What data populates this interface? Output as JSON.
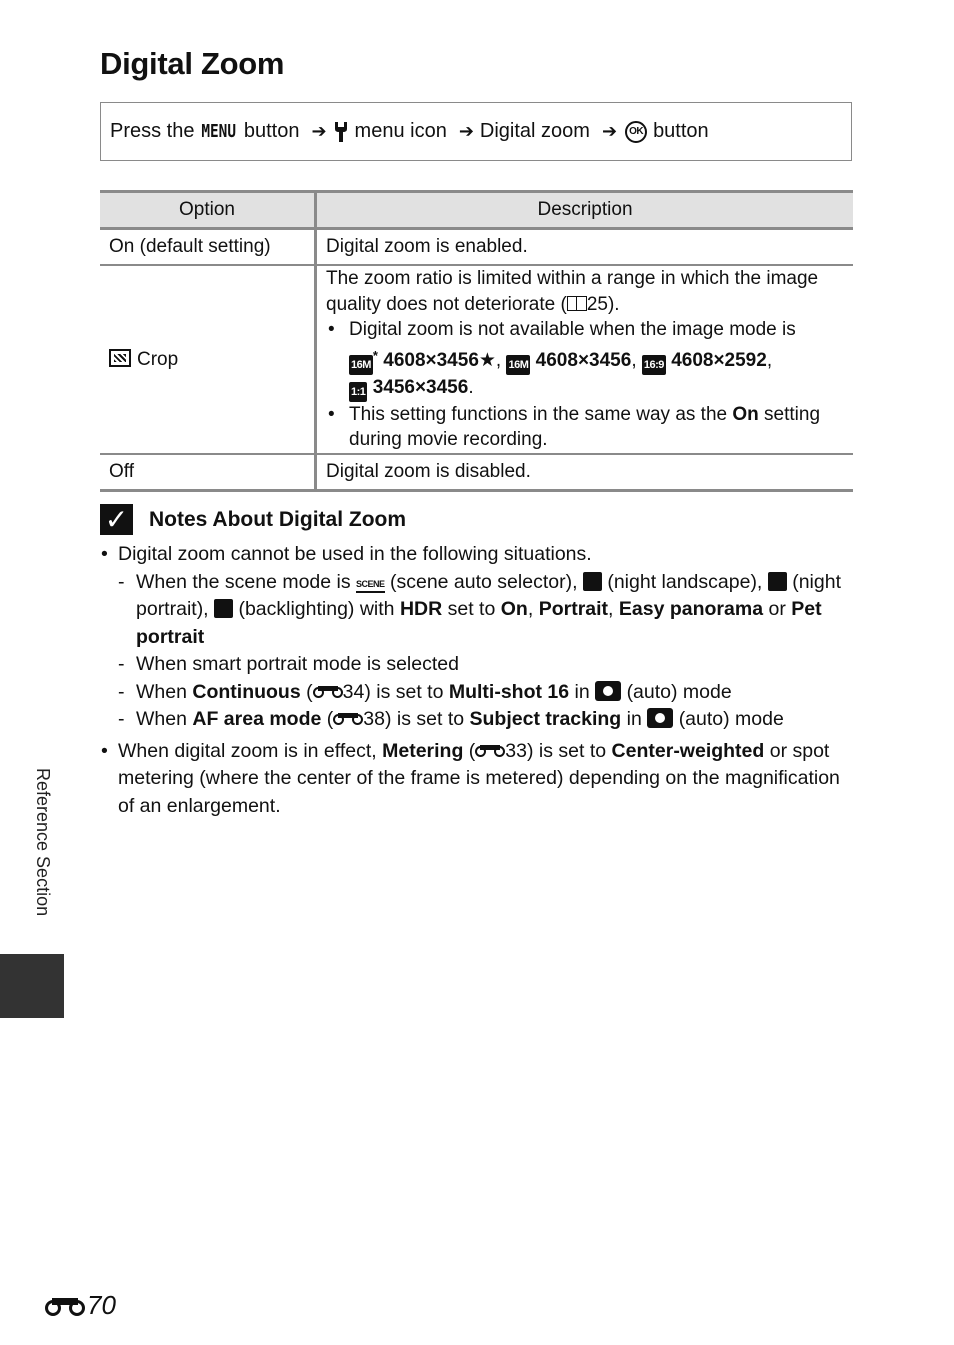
{
  "page": {
    "title": "Digital Zoom",
    "side_label": "Reference Section",
    "page_number": "70"
  },
  "nav_path": {
    "press": "Press the",
    "menu_word": "MENU",
    "button1": "button",
    "arrow": "➔",
    "menu_icon_label": "menu icon",
    "item": "Digital zoom",
    "ok": "OK",
    "button2": "button"
  },
  "table": {
    "headers": [
      "Option",
      "Description"
    ],
    "rows": [
      {
        "option": "On (default setting)",
        "description": "Digital zoom is enabled."
      },
      {
        "option": "Crop",
        "description_intro_a": "The zoom ratio is limited within a range in which the image quality does not deteriorate (",
        "description_intro_ref": "25",
        "description_intro_b": ").",
        "bullet1_text": "Digital zoom is not available when the image mode is",
        "modes": [
          {
            "icon": "16M*",
            "label": "4608×3456★"
          },
          {
            "icon": "16M",
            "label": "4608×3456"
          },
          {
            "icon": "16:9 12M",
            "label": "4608×2592"
          },
          {
            "icon": "1:1",
            "label": "3456×3456"
          }
        ],
        "bullet2_a": "This setting functions in the same way as the",
        "bullet2_bold": "On",
        "bullet2_b": "setting during movie recording."
      },
      {
        "option": "Off",
        "description": "Digital zoom is disabled."
      }
    ]
  },
  "notes": {
    "heading": "Notes About Digital Zoom",
    "item1": "Digital zoom cannot be used in the following situations.",
    "sub1": {
      "a": "When the scene mode is",
      "scene_icon": "SCENE",
      "b": "(scene auto selector),",
      "c": "(night landscape),",
      "d": "(night portrait),",
      "e": "(backlighting) with",
      "hdr": "HDR",
      "f": "set to",
      "on": "On",
      "portrait": "Portrait",
      "easy_panorama": "Easy panorama",
      "or": "or",
      "pet_portrait": "Pet portrait"
    },
    "sub2": "When smart portrait mode is selected",
    "sub3": {
      "a": "When",
      "bold1": "Continuous",
      "ref": "34",
      "b": "is set to",
      "bold2": "Multi-shot 16",
      "c": "in",
      "d": "(auto) mode"
    },
    "sub4": {
      "a": "When",
      "bold1": "AF area mode",
      "ref": "38",
      "b": "is set to",
      "bold2": "Subject tracking",
      "c": "in",
      "d": "(auto) mode"
    },
    "item2": {
      "a": "When digital zoom is in effect,",
      "bold1": "Metering",
      "ref": "33",
      "b": "is set to",
      "bold2": "Center-weighted",
      "c": "or spot metering (where the center of the frame is metered) depending on the magnification of an enlargement."
    }
  }
}
